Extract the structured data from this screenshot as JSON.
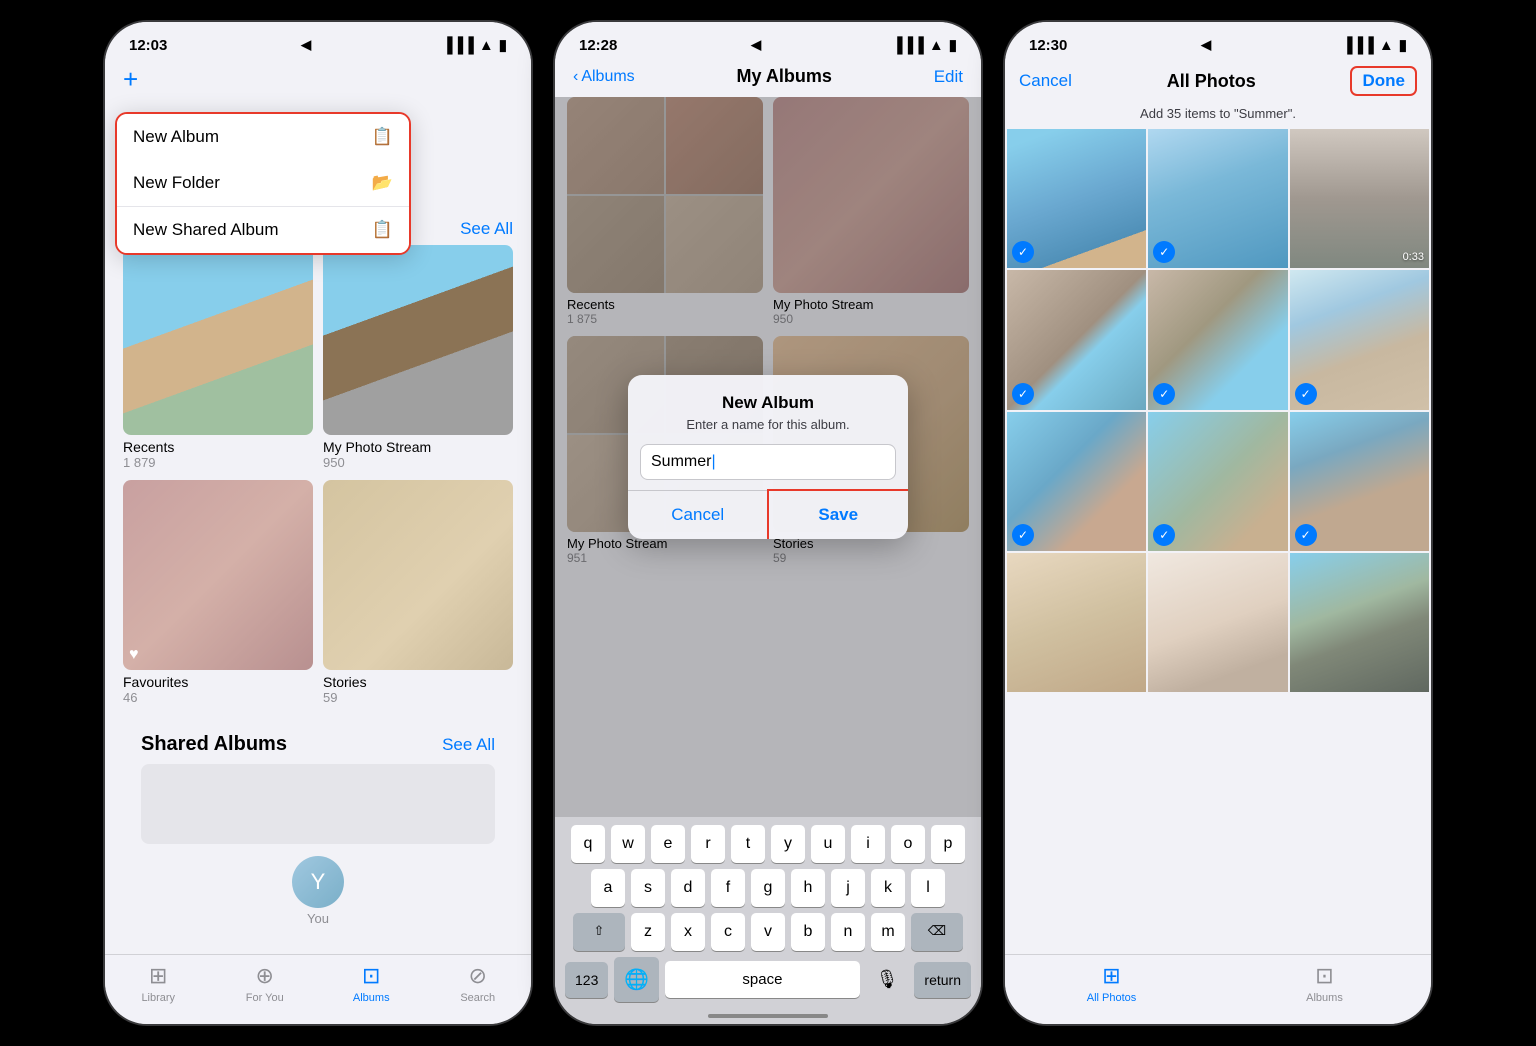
{
  "phones": {
    "phone1": {
      "status": {
        "time": "12:03",
        "location_icon": "◀",
        "signal": "▐▐▐",
        "wifi": "wifi",
        "battery": "🔋"
      },
      "plus_btn": "+",
      "red_arrow": "→",
      "menu": {
        "new_album": "New Album",
        "new_album_icon": "📋",
        "new_folder": "New Folder",
        "new_folder_icon": "📂",
        "new_shared_album": "New Shared Album",
        "new_shared_icon": "📋"
      },
      "see_all": "See All",
      "albums": [
        {
          "name": "Recents",
          "count": "1 879"
        },
        {
          "name": "My Photo Stream",
          "count": "950"
        },
        {
          "name": "Favourites",
          "count": "46"
        },
        {
          "name": "Stories",
          "count": "59"
        }
      ],
      "shared_section": {
        "title": "Shared Albums",
        "see_all": "See All"
      },
      "you_label": "You",
      "tabs": [
        {
          "label": "Library",
          "icon": "⊞",
          "active": false
        },
        {
          "label": "For You",
          "icon": "⊕",
          "active": false
        },
        {
          "label": "Albums",
          "icon": "⊡",
          "active": true
        },
        {
          "label": "Search",
          "icon": "⊘",
          "active": false
        }
      ]
    },
    "phone2": {
      "status": {
        "time": "12:28"
      },
      "nav": {
        "back": "Albums",
        "title": "My Albums",
        "edit": "Edit"
      },
      "albums": [
        {
          "name": "Recents",
          "count": "1 875"
        },
        {
          "name": "My Photo Stream",
          "count": "950"
        },
        {
          "name": "My Photo Stream",
          "count": "951"
        },
        {
          "name": "Stories",
          "count": "59"
        }
      ],
      "dialog": {
        "title": "New Album",
        "subtitle": "Enter a name for this album.",
        "input_value": "Summer",
        "cancel": "Cancel",
        "save": "Save"
      },
      "keyboard": {
        "rows": [
          [
            "q",
            "w",
            "e",
            "r",
            "t",
            "y",
            "u",
            "i",
            "o",
            "p"
          ],
          [
            "a",
            "s",
            "d",
            "f",
            "g",
            "h",
            "j",
            "k",
            "l"
          ],
          [
            "z",
            "x",
            "c",
            "v",
            "b",
            "n",
            "m"
          ]
        ],
        "shift": "⇧",
        "delete": "⌫",
        "numbers": "123",
        "emoji": "🌐",
        "space": "space",
        "return": "return",
        "mic": "🎙"
      }
    },
    "phone3": {
      "status": {
        "time": "12:30"
      },
      "nav": {
        "cancel": "Cancel",
        "title": "All Photos",
        "done": "Done"
      },
      "subtitle": "Add 35 items to \"Summer\".",
      "photos": [
        {
          "type": "mountain",
          "checked": true,
          "class": "photo-mountain-blue"
        },
        {
          "type": "sky",
          "checked": true,
          "class": "photo-sky-clear"
        },
        {
          "type": "woman",
          "checked": false,
          "class": "photo-dark-woman",
          "duration": "0:33"
        },
        {
          "type": "terrace",
          "checked": true,
          "class": "photo-terrace"
        },
        {
          "type": "terrace2",
          "checked": true,
          "class": "photo-terrace2"
        },
        {
          "type": "woman-hat",
          "checked": true,
          "class": "photo-woman-hat"
        },
        {
          "type": "man-sit",
          "checked": true,
          "class": "photo-man-sit"
        },
        {
          "type": "bench",
          "checked": true,
          "class": "photo-bench"
        },
        {
          "type": "bench2",
          "checked": true,
          "class": "photo-bench2"
        },
        {
          "type": "family",
          "checked": false,
          "class": "photo-family"
        },
        {
          "type": "arch",
          "checked": false,
          "class": "photo-arch"
        },
        {
          "type": "castle",
          "checked": false,
          "class": "photo-castle"
        }
      ],
      "tabs": [
        {
          "label": "All Photos",
          "icon": "⊞",
          "active": true
        },
        {
          "label": "Albums",
          "icon": "⊡",
          "active": false
        }
      ]
    }
  }
}
